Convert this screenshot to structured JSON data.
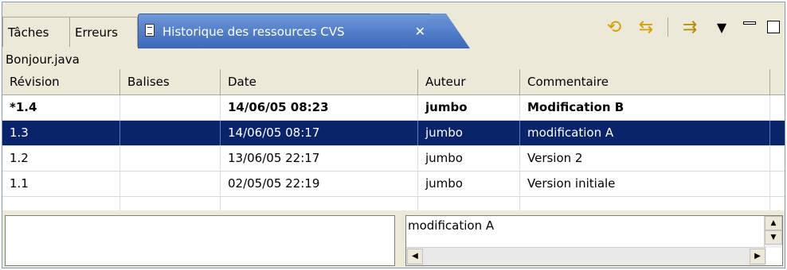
{
  "tabs": [
    {
      "label": "Tâches"
    },
    {
      "label": "Erreurs"
    }
  ],
  "active_tab": {
    "label": "Historique des ressources CVS",
    "close": "✕"
  },
  "toolbar": {
    "icons": [
      "refresh-icon",
      "link-with-editor-icon",
      "compare-icon",
      "view-menu-icon",
      "minimize-icon",
      "maximize-icon"
    ],
    "view_menu": "▼"
  },
  "file": {
    "name": "Bonjour.java"
  },
  "table": {
    "headers": [
      "Révision",
      "Balises",
      "Date",
      "Auteur",
      "Commentaire"
    ],
    "rows": [
      {
        "revision": "*1.4",
        "tags": "",
        "date": "14/06/05 08:23",
        "author": "jumbo",
        "comment": "Modification B"
      },
      {
        "revision": "1.3",
        "tags": "",
        "date": "14/06/05 08:17",
        "author": "jumbo",
        "comment": "modification A"
      },
      {
        "revision": "1.2",
        "tags": "",
        "date": "13/06/05 22:17",
        "author": "jumbo",
        "comment": "Version 2"
      },
      {
        "revision": "1.1",
        "tags": "",
        "date": "02/05/05 22:19",
        "author": "jumbo",
        "comment": "Version initiale"
      }
    ],
    "selected_revision": "1.3",
    "current_revision": "*1.4"
  },
  "comment_pane": {
    "text": "modification A"
  },
  "colors": {
    "selection": "#0a246a",
    "tab_active": "#3a67b8",
    "chrome": "#ece9d8"
  }
}
